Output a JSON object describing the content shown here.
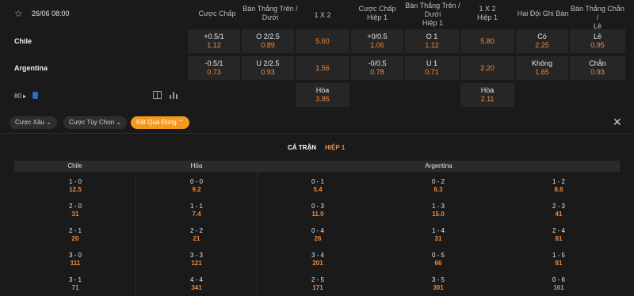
{
  "match": {
    "datetime": "26/06 08:00",
    "home": "Chile",
    "away": "Argentina",
    "more_count": "80"
  },
  "columns": {
    "c1": "Cược Chấp",
    "c2a": "Bàn Thắng Trên /",
    "c2b": "Dưới",
    "c3": "1 X 2",
    "c4a": "Cược Chấp",
    "c4b": "Hiệp 1",
    "c5a": "Bàn Thắng Trên /",
    "c5b": "Dưới",
    "c5c": "Hiệp 1",
    "c6a": "1 X 2",
    "c6b": "Hiệp 1",
    "c7": "Hai Đội Ghi Bàn",
    "c8a": "Bàn Thắng Chẵn /",
    "c8b": "Lẻ"
  },
  "odds": {
    "r1": {
      "hdp": {
        "l": "+0.5/1",
        "v": "1.12"
      },
      "ou": {
        "l": "O 2/2.5",
        "v": "0.89"
      },
      "x12": {
        "v": "5.60"
      },
      "hdp1": {
        "l": "+0/0.5",
        "v": "1.06"
      },
      "ou1": {
        "l": "O 1",
        "v": "1.12"
      },
      "x121": {
        "v": "5.80"
      },
      "btts": {
        "l": "Có",
        "v": "2.25"
      },
      "oe": {
        "l": "Lẻ",
        "v": "0.95"
      }
    },
    "r2": {
      "hdp": {
        "l": "-0.5/1",
        "v": "0.73"
      },
      "ou": {
        "l": "U 2/2.5",
        "v": "0.93"
      },
      "x12": {
        "v": "1.56"
      },
      "hdp1": {
        "l": "-0/0.5",
        "v": "0.78"
      },
      "ou1": {
        "l": "U 1",
        "v": "0.71"
      },
      "x121": {
        "v": "2.20"
      },
      "btts": {
        "l": "Không",
        "v": "1.65"
      },
      "oe": {
        "l": "Chẵn",
        "v": "0.93"
      }
    },
    "r3": {
      "draw": {
        "l": "Hòa",
        "v": "3.85"
      },
      "draw1": {
        "l": "Hòa",
        "v": "2.11"
      }
    }
  },
  "filters": {
    "f1": "Cược Xâu",
    "f2": "Cược Tùy Chọn",
    "f3": "Kết Quả Đúng"
  },
  "tabs": {
    "t1": "CẢ TRẬN",
    "t2": "HIỆP 1"
  },
  "score_table": {
    "headers": {
      "home": "Chile",
      "draw": "Hòa",
      "away": "Argentina"
    },
    "home": [
      {
        "s": "1 - 0",
        "o": "12.5"
      },
      {
        "s": "2 - 0",
        "o": "31"
      },
      {
        "s": "2 - 1",
        "o": "20"
      },
      {
        "s": "3 - 0",
        "o": "111"
      },
      {
        "s": "3 - 1",
        "o": "71"
      }
    ],
    "draw": [
      {
        "s": "0 - 0",
        "o": "9.2"
      },
      {
        "s": "1 - 1",
        "o": "7.4"
      },
      {
        "s": "2 - 2",
        "o": "21"
      },
      {
        "s": "3 - 3",
        "o": "121"
      },
      {
        "s": "4 - 4",
        "o": "341"
      }
    ],
    "away1": [
      {
        "s": "0 - 1",
        "o": "5.4"
      },
      {
        "s": "0 - 3",
        "o": "11.0"
      },
      {
        "s": "0 - 4",
        "o": "26"
      },
      {
        "s": "3 - 4",
        "o": "201"
      },
      {
        "s": "2 - 5",
        "o": "171"
      }
    ],
    "away2": [
      {
        "s": "0 - 2",
        "o": "6.3"
      },
      {
        "s": "1 - 3",
        "o": "15.0"
      },
      {
        "s": "1 - 4",
        "o": "31"
      },
      {
        "s": "0 - 5",
        "o": "66"
      },
      {
        "s": "3 - 5",
        "o": "301"
      }
    ],
    "away3": [
      {
        "s": "1 - 2",
        "o": "8.6"
      },
      {
        "s": "2 - 3",
        "o": "41"
      },
      {
        "s": "2 - 4",
        "o": "81"
      },
      {
        "s": "1 - 5",
        "o": "81"
      },
      {
        "s": "0 - 6",
        "o": "161"
      }
    ]
  },
  "colors": {
    "accent": "#f39a1c",
    "odds": "#f08a3c",
    "tab_active": "#ffffff",
    "tab_inactive": "#f08a3c"
  }
}
